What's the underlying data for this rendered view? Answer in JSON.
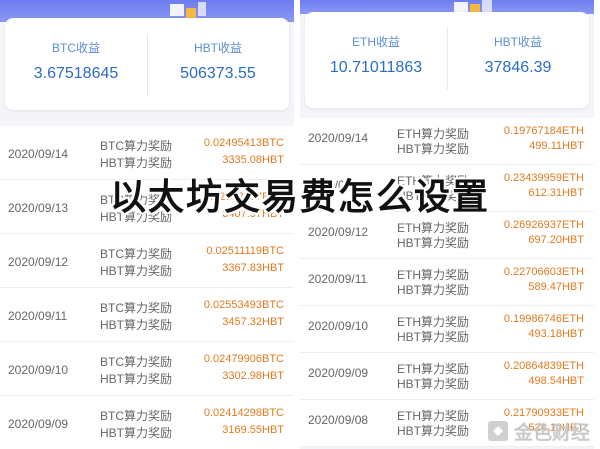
{
  "left": {
    "summary": {
      "left_label": "BTC收益",
      "left_value": "3.67518645",
      "right_label": "HBT收益",
      "right_value": "506373.55"
    },
    "rows": [
      {
        "date": "2020/09/14",
        "label1": "BTC算力奖励",
        "value1": "0.02495413BTC",
        "label2": "HBT算力奖励",
        "value2": "3335.08HBT"
      },
      {
        "date": "2020/09/13",
        "label1": "BTC算力奖励",
        "value1": "0.02533707BTC",
        "label2": "HBT算力奖励",
        "value2": "3407.57HBT"
      },
      {
        "date": "2020/09/12",
        "label1": "BTC算力奖励",
        "value1": "0.02511119BTC",
        "label2": "HBT算力奖励",
        "value2": "3367.83HBT"
      },
      {
        "date": "2020/09/11",
        "label1": "BTC算力奖励",
        "value1": "0.02553493BTC",
        "label2": "HBT算力奖励",
        "value2": "3457.32HBT"
      },
      {
        "date": "2020/09/10",
        "label1": "BTC算力奖励",
        "value1": "0.02479906BTC",
        "label2": "HBT算力奖励",
        "value2": "3302.98HBT"
      },
      {
        "date": "2020/09/09",
        "label1": "BTC算力奖励",
        "value1": "0.02414298BTC",
        "label2": "HBT算力奖励",
        "value2": "3169.55HBT"
      }
    ]
  },
  "right": {
    "summary": {
      "left_label": "ETH收益",
      "left_value": "10.71011863",
      "right_label": "HBT收益",
      "right_value": "37846.39"
    },
    "rows": [
      {
        "date": "2020/09/14",
        "label1": "ETH算力奖励",
        "value1": "0.19767184ETH",
        "label2": "HBT算力奖励",
        "value2": "499.11HBT"
      },
      {
        "date": "2020/09/13",
        "label1": "ETH算力奖励",
        "value1": "0.23439959ETH",
        "label2": "HBT算力奖励",
        "value2": "612.31HBT"
      },
      {
        "date": "2020/09/12",
        "label1": "ETH算力奖励",
        "value1": "0.26926937ETH",
        "label2": "HBT算力奖励",
        "value2": "697.20HBT"
      },
      {
        "date": "2020/09/11",
        "label1": "ETH算力奖励",
        "value1": "0.22706603ETH",
        "label2": "HBT算力奖励",
        "value2": "589.47HBT"
      },
      {
        "date": "2020/09/10",
        "label1": "ETH算力奖励",
        "value1": "0.19986746ETH",
        "label2": "HBT算力奖励",
        "value2": "493.18HBT"
      },
      {
        "date": "2020/09/09",
        "label1": "ETH算力奖励",
        "value1": "0.20864839ETH",
        "label2": "HBT算力奖励",
        "value2": "498.54HBT"
      },
      {
        "date": "2020/09/08",
        "label1": "ETH算力奖励",
        "value1": "0.21790933ETH",
        "label2": "HBT算力奖励",
        "value2": "528.10HBT"
      }
    ]
  },
  "overlay_title": "以太坊交易费怎么设置",
  "watermark": {
    "text": "金色财经",
    "icon": "jinse-logo-icon"
  },
  "colors": {
    "accent_blue": "#2b6cc4",
    "value_orange": "#e07a1f",
    "banner": "#6d7df0"
  }
}
